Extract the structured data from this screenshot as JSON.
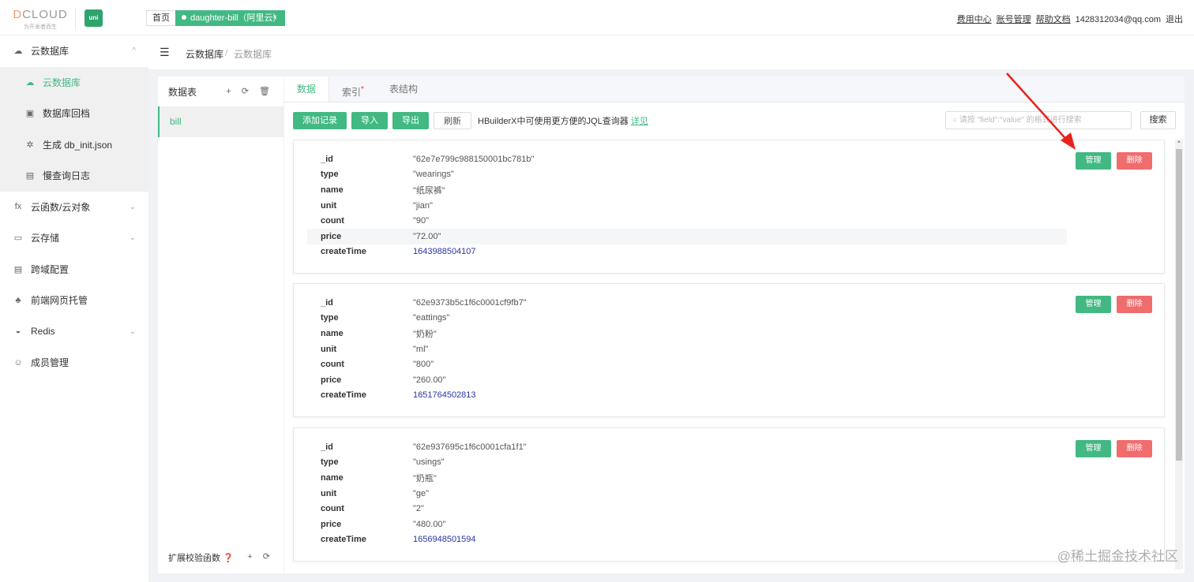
{
  "header": {
    "logo_text": "DCLOUD",
    "logo_slogan": "为开发者而生",
    "uni_badge": "uni",
    "tab_home": "首页",
    "tab_active": "daughter-bill（阿里云）",
    "tab_close": "×",
    "links": [
      "费用中心",
      "账号管理",
      "帮助文档"
    ],
    "email": "1428312034@qq.com",
    "logout": "退出"
  },
  "sidebar": {
    "items": [
      {
        "icon": "cloud-db-icon",
        "glyph": "☁",
        "label": "云数据库",
        "chev": "^"
      },
      {
        "icon": "function-icon",
        "glyph": "fx",
        "label": "云函数/云对象",
        "chev": "⌄"
      },
      {
        "icon": "storage-icon",
        "glyph": "▭",
        "label": "云存储",
        "chev": "⌄"
      },
      {
        "icon": "cors-icon",
        "glyph": "▤",
        "label": "跨域配置"
      },
      {
        "icon": "hosting-icon",
        "glyph": "♣",
        "label": "前端网页托管"
      },
      {
        "icon": "redis-icon",
        "glyph": "◒",
        "label": "Redis",
        "chev": "⌄"
      },
      {
        "icon": "members-icon",
        "glyph": "☺",
        "label": "成员管理"
      }
    ],
    "subitems": [
      {
        "icon": "cloud-db-icon",
        "glyph": "☁",
        "label": "云数据库"
      },
      {
        "icon": "backup-icon",
        "glyph": "▣",
        "label": "数据库回档"
      },
      {
        "icon": "generate-icon",
        "glyph": "✲",
        "label": "生成 db_init.json"
      },
      {
        "icon": "log-icon",
        "glyph": "▤",
        "label": "慢查询日志"
      }
    ]
  },
  "breadcrumb": {
    "first": "云数据库",
    "sep": "/",
    "second": "云数据库"
  },
  "tables": {
    "title": "数据表",
    "actions": "+ ⟳ 🗑",
    "items": [
      "bill"
    ],
    "footer": "扩展校验函数 ❓",
    "footer_actions": "+ ⟳"
  },
  "tabs": [
    "数据",
    "索引",
    "表结构"
  ],
  "tab_mark": "*",
  "toolbar": {
    "add": "添加记录",
    "import": "导入",
    "export": "导出",
    "refresh": "刷新",
    "hint": "HBuilderX中可使用更方便的JQL查询器",
    "hint_link": "详见",
    "search_placeholder": "请按 \"field\":\"value\" 的格式进行搜索",
    "search_btn": "搜索"
  },
  "card_actions": {
    "manage": "管理",
    "delete": "删除"
  },
  "records": [
    [
      [
        "_id",
        "\"62e7e799c988150001bc781b\""
      ],
      [
        "type",
        "\"wearings\""
      ],
      [
        "name",
        "\"纸尿裤\""
      ],
      [
        "unit",
        "\"jian\""
      ],
      [
        "count",
        "\"90\""
      ],
      [
        "price",
        "\"72.00\""
      ],
      [
        "createTime",
        "1643988504107"
      ]
    ],
    [
      [
        "_id",
        "\"62e9373b5c1f6c0001cf9fb7\""
      ],
      [
        "type",
        "\"eattings\""
      ],
      [
        "name",
        "\"奶粉\""
      ],
      [
        "unit",
        "\"ml\""
      ],
      [
        "count",
        "\"800\""
      ],
      [
        "price",
        "\"260.00\""
      ],
      [
        "createTime",
        "1651764502813"
      ]
    ],
    [
      [
        "_id",
        "\"62e937695c1f6c0001cfa1f1\""
      ],
      [
        "type",
        "\"usings\""
      ],
      [
        "name",
        "\"奶瓶\""
      ],
      [
        "unit",
        "\"ge\""
      ],
      [
        "count",
        "\"2\""
      ],
      [
        "price",
        "\"480.00\""
      ],
      [
        "createTime",
        "1656948501594"
      ]
    ]
  ],
  "watermark": "@稀土掘金技术社区",
  "colors": {
    "accent": "#42b983",
    "danger": "#f06d6d",
    "number": "#2a35a5"
  }
}
